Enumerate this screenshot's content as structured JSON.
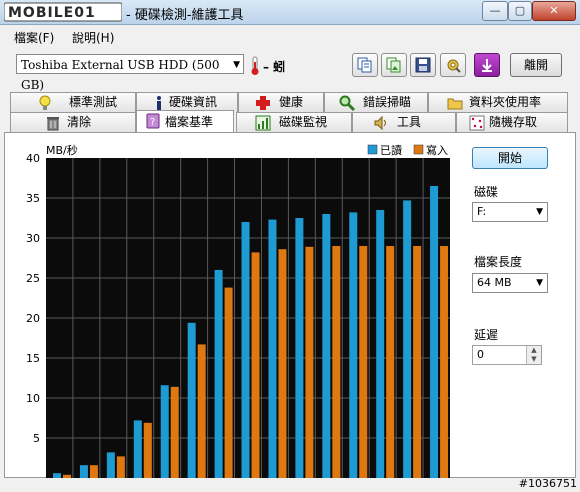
{
  "window": {
    "brand": "MOBILE01",
    "title": "- 硬碟檢測-維護工具"
  },
  "menu": [
    {
      "label": "檔案(F)"
    },
    {
      "label": "說明(H)"
    }
  ],
  "toolbar": {
    "drive_select": "Toshiba External USB HDD (500 GB)",
    "temperature": "– 蚓",
    "exit_label": "離開"
  },
  "tabs": {
    "row1": [
      "標準測試",
      "硬碟資訊",
      "健康",
      "錯誤掃瞄",
      "資料夾使用率"
    ],
    "row2": [
      "清除",
      "檔案基準",
      "磁碟監視",
      "工具",
      "隨機存取"
    ]
  },
  "side": {
    "start_label": "開始",
    "drive_label": "磁碟",
    "drive_value": "F:",
    "length_label": "檔案長度",
    "length_value": "64 MB",
    "delay_label": "延遲",
    "delay_value": "0"
  },
  "chart_data": {
    "type": "bar",
    "ylabel": "MB/秒",
    "ylim": [
      0,
      40
    ],
    "yticks": [
      5,
      10,
      15,
      20,
      25,
      30,
      35,
      40
    ],
    "grid": true,
    "legend_position": "top-right",
    "series": [
      {
        "name": "已讀",
        "color": "#1f9bd3",
        "values": [
          0.6,
          1.6,
          3.2,
          7.2,
          11.6,
          19.4,
          26.0,
          32.0,
          32.3,
          32.5,
          33.0,
          33.2,
          33.5,
          34.7,
          36.5
        ]
      },
      {
        "name": "寫入",
        "color": "#e07812",
        "values": [
          0.4,
          1.6,
          2.7,
          6.9,
          11.4,
          16.7,
          23.8,
          28.2,
          28.6,
          28.9,
          29.0,
          29.0,
          29.0,
          29.0,
          29.0
        ]
      }
    ]
  },
  "watermark": "#1036751"
}
